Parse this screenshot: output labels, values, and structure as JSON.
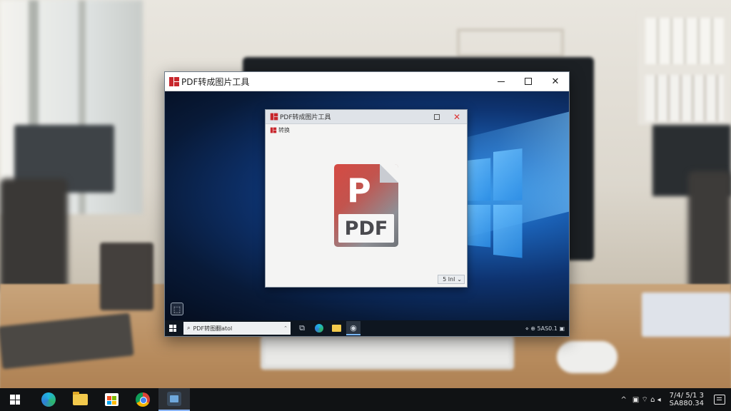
{
  "outer_window": {
    "title": "PDF转成图片工具",
    "min_label": "—",
    "close_label": "✕"
  },
  "inner_window": {
    "title": "PDF转成图片工具",
    "min_label": "",
    "close_label": "✕",
    "menu_label": "转换",
    "pdf_letter": "P",
    "pdf_label": "PDF",
    "zoom_value": "5 lnl",
    "zoom_arrow": "⌄"
  },
  "inner_taskbar": {
    "search_text": "PDF转图翻atol",
    "mic_glyph": "⌃",
    "tray_text": "⋄ ⊕ 5AS0.1 ▣"
  },
  "desktop": {
    "icon_glyph": "⬚"
  },
  "host_taskbar": {
    "tray_chevron": "^",
    "tray_icons": "▣ ⌔ ⌂ ◂",
    "clock_time": "7/4/ 5/1 3",
    "clock_date": "SA880.34"
  },
  "colors": {
    "logo_red": "#c8272d",
    "desktop_blue": "#1a5fb3",
    "taskbar": "#101214"
  }
}
